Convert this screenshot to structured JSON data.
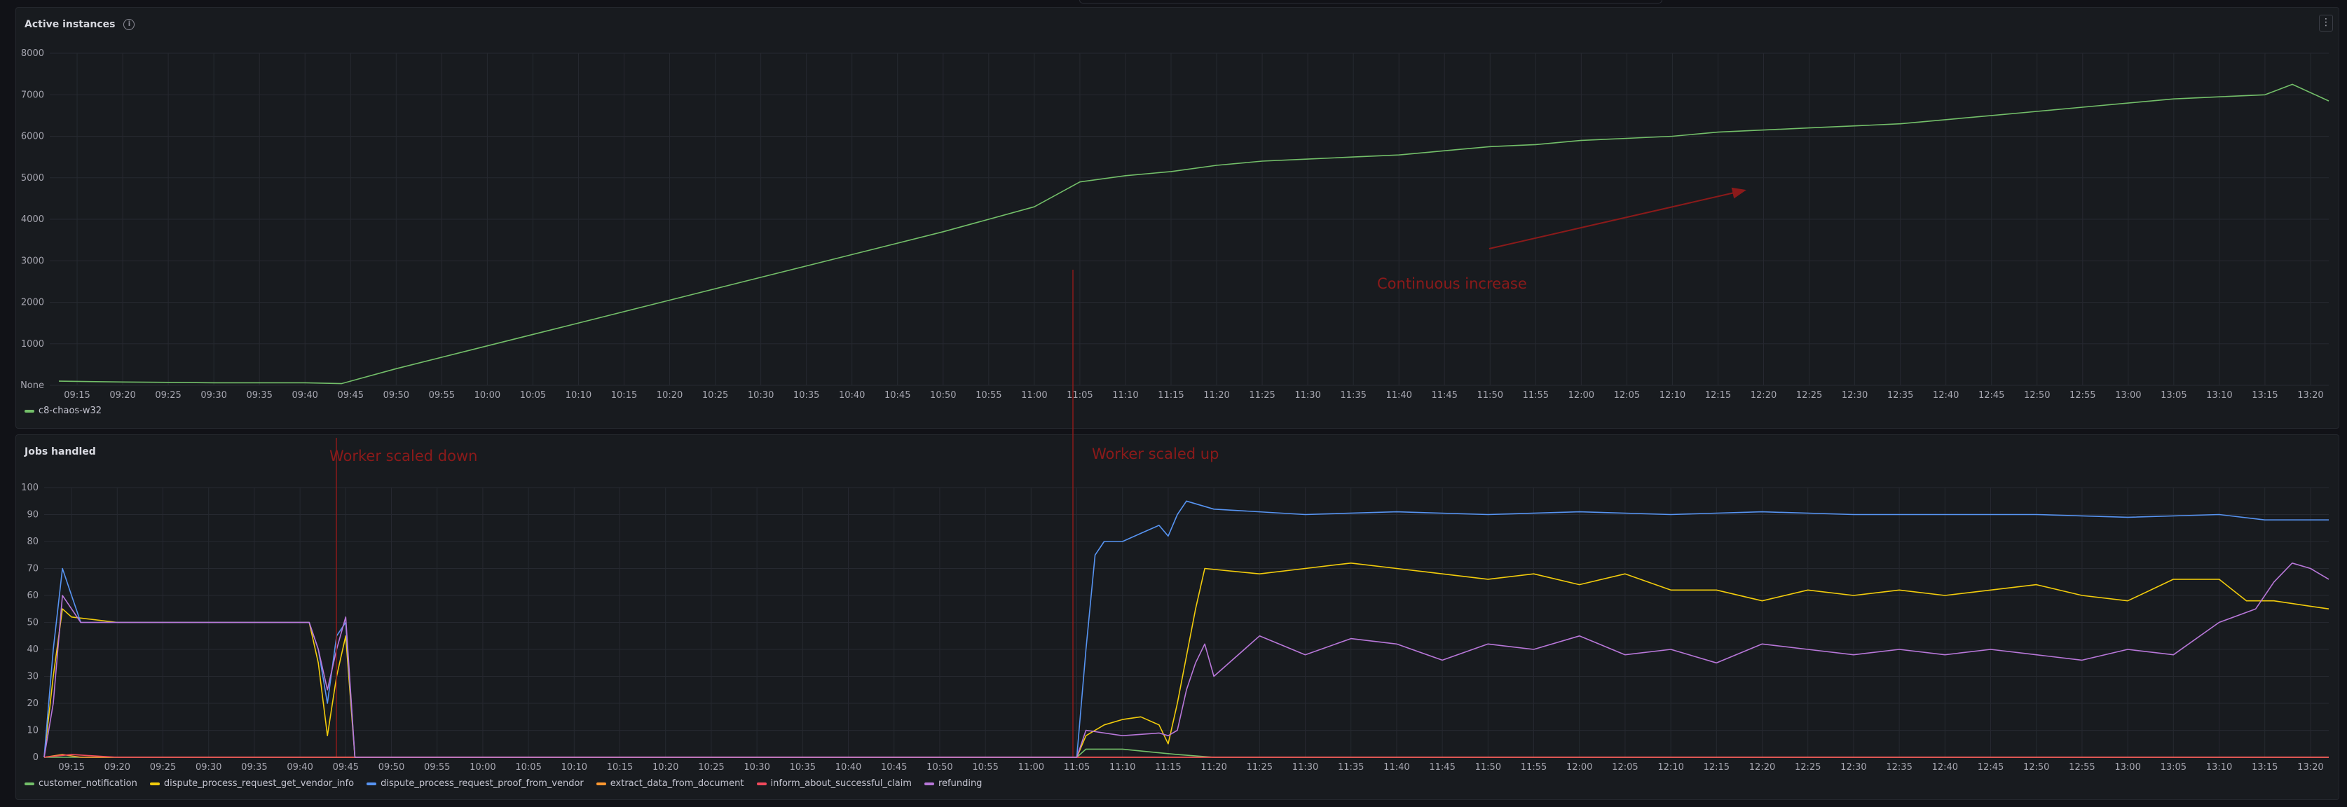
{
  "colors": {
    "green": "#73bf69",
    "yellow": "#f2cc0c",
    "blue": "#5794f2",
    "orange": "#ff9830",
    "red": "#f2495c",
    "purple": "#b877d9",
    "annotation": "#8b1a1a"
  },
  "icons": {
    "info": "info-icon",
    "menu": "kebab-menu-icon"
  },
  "panel_active": {
    "title": "Active instances",
    "legend": [
      {
        "name": "c8-chaos-w32",
        "color": "#73bf69"
      }
    ]
  },
  "panel_jobs": {
    "title": "Jobs handled",
    "legend": [
      {
        "name": "customer_notification",
        "color": "#73bf69"
      },
      {
        "name": "dispute_process_request_get_vendor_info",
        "color": "#f2cc0c"
      },
      {
        "name": "dispute_process_request_proof_from_vendor",
        "color": "#5794f2"
      },
      {
        "name": "extract_data_from_document",
        "color": "#ff9830"
      },
      {
        "name": "inform_about_successful_claim",
        "color": "#f2495c"
      },
      {
        "name": "refunding",
        "color": "#b877d9"
      }
    ]
  },
  "annotations": {
    "continuous_increase": "Continuous increase",
    "worker_scaled_down": "Worker scaled down",
    "worker_scaled_up": "Worker scaled up"
  },
  "chart_data": [
    {
      "type": "line",
      "title": "Active instances",
      "xlabel": "",
      "ylabel": "",
      "x_range": [
        "09:12",
        "13:22"
      ],
      "y_ticks": [
        "None",
        "1000",
        "2000",
        "3000",
        "4000",
        "5000",
        "6000",
        "7000",
        "8000"
      ],
      "x_ticks": [
        "09:15",
        "09:20",
        "09:25",
        "09:30",
        "09:35",
        "09:40",
        "09:45",
        "09:50",
        "09:55",
        "10:00",
        "10:05",
        "10:10",
        "10:15",
        "10:20",
        "10:25",
        "10:30",
        "10:35",
        "10:40",
        "10:45",
        "10:50",
        "10:55",
        "11:00",
        "11:05",
        "11:10",
        "11:15",
        "11:20",
        "11:25",
        "11:30",
        "11:35",
        "11:40",
        "11:45",
        "11:50",
        "11:55",
        "12:00",
        "12:05",
        "12:10",
        "12:15",
        "12:20",
        "12:25",
        "12:30",
        "12:35",
        "12:40",
        "12:45",
        "12:50",
        "12:55",
        "13:00",
        "13:05",
        "13:10",
        "13:15",
        "13:20"
      ],
      "ylim": [
        0,
        8000
      ],
      "grid": true,
      "legend_placement": "bottom-left",
      "series": [
        {
          "name": "c8-chaos-w32",
          "points": [
            [
              "09:13",
              100
            ],
            [
              "09:20",
              80
            ],
            [
              "09:30",
              60
            ],
            [
              "09:40",
              60
            ],
            [
              "09:44",
              40
            ],
            [
              "09:50",
              400
            ],
            [
              "10:00",
              950
            ],
            [
              "10:10",
              1500
            ],
            [
              "10:20",
              2050
            ],
            [
              "10:30",
              2600
            ],
            [
              "10:40",
              3150
            ],
            [
              "10:50",
              3700
            ],
            [
              "11:00",
              4300
            ],
            [
              "11:05",
              4900
            ],
            [
              "11:10",
              5050
            ],
            [
              "11:15",
              5150
            ],
            [
              "11:20",
              5300
            ],
            [
              "11:25",
              5400
            ],
            [
              "11:30",
              5450
            ],
            [
              "11:35",
              5500
            ],
            [
              "11:40",
              5550
            ],
            [
              "11:45",
              5650
            ],
            [
              "11:50",
              5750
            ],
            [
              "11:55",
              5800
            ],
            [
              "12:00",
              5900
            ],
            [
              "12:05",
              5950
            ],
            [
              "12:10",
              6000
            ],
            [
              "12:15",
              6100
            ],
            [
              "12:20",
              6150
            ],
            [
              "12:25",
              6200
            ],
            [
              "12:30",
              6250
            ],
            [
              "12:35",
              6300
            ],
            [
              "12:40",
              6400
            ],
            [
              "12:45",
              6500
            ],
            [
              "12:50",
              6600
            ],
            [
              "12:55",
              6700
            ],
            [
              "13:00",
              6800
            ],
            [
              "13:05",
              6900
            ],
            [
              "13:10",
              6950
            ],
            [
              "13:15",
              7000
            ],
            [
              "13:18",
              7250
            ],
            [
              "13:22",
              6850
            ]
          ]
        }
      ]
    },
    {
      "type": "line",
      "title": "Jobs handled",
      "xlabel": "",
      "ylabel": "",
      "x_range": [
        "09:12",
        "13:22"
      ],
      "y_ticks": [
        "0",
        "10",
        "20",
        "30",
        "40",
        "50",
        "60",
        "70",
        "80",
        "90",
        "100"
      ],
      "x_ticks": [
        "09:15",
        "09:20",
        "09:25",
        "09:30",
        "09:35",
        "09:40",
        "09:45",
        "09:50",
        "09:55",
        "10:00",
        "10:05",
        "10:10",
        "10:15",
        "10:20",
        "10:25",
        "10:30",
        "10:35",
        "10:40",
        "10:45",
        "10:50",
        "10:55",
        "11:00",
        "11:05",
        "11:10",
        "11:15",
        "11:20",
        "11:25",
        "11:30",
        "11:35",
        "11:40",
        "11:45",
        "11:50",
        "11:55",
        "12:00",
        "12:05",
        "12:10",
        "12:15",
        "12:20",
        "12:25",
        "12:30",
        "12:35",
        "12:40",
        "12:45",
        "12:50",
        "12:55",
        "13:00",
        "13:05",
        "13:10",
        "13:15",
        "13:20"
      ],
      "ylim": [
        0,
        100
      ],
      "grid": true,
      "legend_placement": "bottom-left",
      "series": [
        {
          "name": "customer_notification",
          "points": [
            [
              "09:12",
              0
            ],
            [
              "11:05",
              0
            ],
            [
              "11:06",
              3
            ],
            [
              "11:10",
              3
            ],
            [
              "11:13",
              2
            ],
            [
              "11:16",
              1
            ],
            [
              "11:20",
              0
            ],
            [
              "13:22",
              0
            ]
          ]
        },
        {
          "name": "dispute_process_request_get_vendor_info",
          "points": [
            [
              "09:12",
              0
            ],
            [
              "09:13",
              30
            ],
            [
              "09:14",
              55
            ],
            [
              "09:15",
              52
            ],
            [
              "09:20",
              50
            ],
            [
              "09:30",
              50
            ],
            [
              "09:41",
              50
            ],
            [
              "09:42",
              35
            ],
            [
              "09:43",
              8
            ],
            [
              "09:44",
              30
            ],
            [
              "09:45",
              45
            ],
            [
              "09:46",
              0
            ],
            [
              "11:05",
              0
            ],
            [
              "11:06",
              8
            ],
            [
              "11:08",
              12
            ],
            [
              "11:10",
              14
            ],
            [
              "11:12",
              15
            ],
            [
              "11:14",
              12
            ],
            [
              "11:15",
              5
            ],
            [
              "11:16",
              20
            ],
            [
              "11:18",
              55
            ],
            [
              "11:19",
              70
            ],
            [
              "11:25",
              68
            ],
            [
              "11:30",
              70
            ],
            [
              "11:35",
              72
            ],
            [
              "11:40",
              70
            ],
            [
              "11:45",
              68
            ],
            [
              "11:50",
              66
            ],
            [
              "11:55",
              68
            ],
            [
              "12:00",
              64
            ],
            [
              "12:05",
              68
            ],
            [
              "12:10",
              62
            ],
            [
              "12:15",
              62
            ],
            [
              "12:20",
              58
            ],
            [
              "12:25",
              62
            ],
            [
              "12:30",
              60
            ],
            [
              "12:35",
              62
            ],
            [
              "12:40",
              60
            ],
            [
              "12:45",
              62
            ],
            [
              "12:50",
              64
            ],
            [
              "12:55",
              60
            ],
            [
              "13:00",
              58
            ],
            [
              "13:05",
              66
            ],
            [
              "13:10",
              66
            ],
            [
              "13:13",
              58
            ],
            [
              "13:16",
              58
            ],
            [
              "13:20",
              56
            ],
            [
              "13:22",
              55
            ]
          ]
        },
        {
          "name": "dispute_process_request_proof_from_vendor",
          "points": [
            [
              "09:12",
              0
            ],
            [
              "09:13",
              40
            ],
            [
              "09:14",
              70
            ],
            [
              "09:15",
              60
            ],
            [
              "09:16",
              50
            ],
            [
              "09:20",
              50
            ],
            [
              "09:30",
              50
            ],
            [
              "09:41",
              50
            ],
            [
              "09:42",
              40
            ],
            [
              "09:43",
              20
            ],
            [
              "09:44",
              45
            ],
            [
              "09:45",
              50
            ],
            [
              "09:46",
              0
            ],
            [
              "11:05",
              0
            ],
            [
              "11:06",
              40
            ],
            [
              "11:07",
              75
            ],
            [
              "11:08",
              80
            ],
            [
              "11:10",
              80
            ],
            [
              "11:12",
              83
            ],
            [
              "11:14",
              86
            ],
            [
              "11:15",
              82
            ],
            [
              "11:16",
              90
            ],
            [
              "11:17",
              95
            ],
            [
              "11:20",
              92
            ],
            [
              "11:30",
              90
            ],
            [
              "11:40",
              91
            ],
            [
              "11:50",
              90
            ],
            [
              "12:00",
              91
            ],
            [
              "12:10",
              90
            ],
            [
              "12:20",
              91
            ],
            [
              "12:30",
              90
            ],
            [
              "12:40",
              90
            ],
            [
              "12:50",
              90
            ],
            [
              "13:00",
              89
            ],
            [
              "13:10",
              90
            ],
            [
              "13:15",
              88
            ],
            [
              "13:22",
              88
            ]
          ]
        },
        {
          "name": "extract_data_from_document",
          "points": [
            [
              "09:12",
              0
            ],
            [
              "09:14",
              1
            ],
            [
              "09:16",
              0
            ],
            [
              "13:22",
              0
            ]
          ]
        },
        {
          "name": "inform_about_successful_claim",
          "points": [
            [
              "09:12",
              0
            ],
            [
              "09:15",
              1
            ],
            [
              "09:20",
              0
            ],
            [
              "13:22",
              0
            ]
          ]
        },
        {
          "name": "refunding",
          "points": [
            [
              "09:12",
              0
            ],
            [
              "09:13",
              20
            ],
            [
              "09:14",
              60
            ],
            [
              "09:15",
              55
            ],
            [
              "09:16",
              50
            ],
            [
              "09:20",
              50
            ],
            [
              "09:30",
              50
            ],
            [
              "09:41",
              50
            ],
            [
              "09:42",
              40
            ],
            [
              "09:43",
              25
            ],
            [
              "09:44",
              40
            ],
            [
              "09:45",
              52
            ],
            [
              "09:46",
              0
            ],
            [
              "11:05",
              0
            ],
            [
              "11:06",
              10
            ],
            [
              "11:10",
              8
            ],
            [
              "11:14",
              9
            ],
            [
              "11:15",
              8
            ],
            [
              "11:16",
              10
            ],
            [
              "11:17",
              25
            ],
            [
              "11:18",
              35
            ],
            [
              "11:19",
              42
            ],
            [
              "11:20",
              30
            ],
            [
              "11:25",
              45
            ],
            [
              "11:30",
              38
            ],
            [
              "11:35",
              44
            ],
            [
              "11:40",
              42
            ],
            [
              "11:45",
              36
            ],
            [
              "11:50",
              42
            ],
            [
              "11:55",
              40
            ],
            [
              "12:00",
              45
            ],
            [
              "12:05",
              38
            ],
            [
              "12:10",
              40
            ],
            [
              "12:15",
              35
            ],
            [
              "12:20",
              42
            ],
            [
              "12:25",
              40
            ],
            [
              "12:30",
              38
            ],
            [
              "12:35",
              40
            ],
            [
              "12:40",
              38
            ],
            [
              "12:45",
              40
            ],
            [
              "12:50",
              38
            ],
            [
              "12:55",
              36
            ],
            [
              "13:00",
              40
            ],
            [
              "13:05",
              38
            ],
            [
              "13:10",
              50
            ],
            [
              "13:14",
              55
            ],
            [
              "13:16",
              65
            ],
            [
              "13:18",
              72
            ],
            [
              "13:20",
              70
            ],
            [
              "13:22",
              66
            ]
          ]
        }
      ]
    }
  ]
}
